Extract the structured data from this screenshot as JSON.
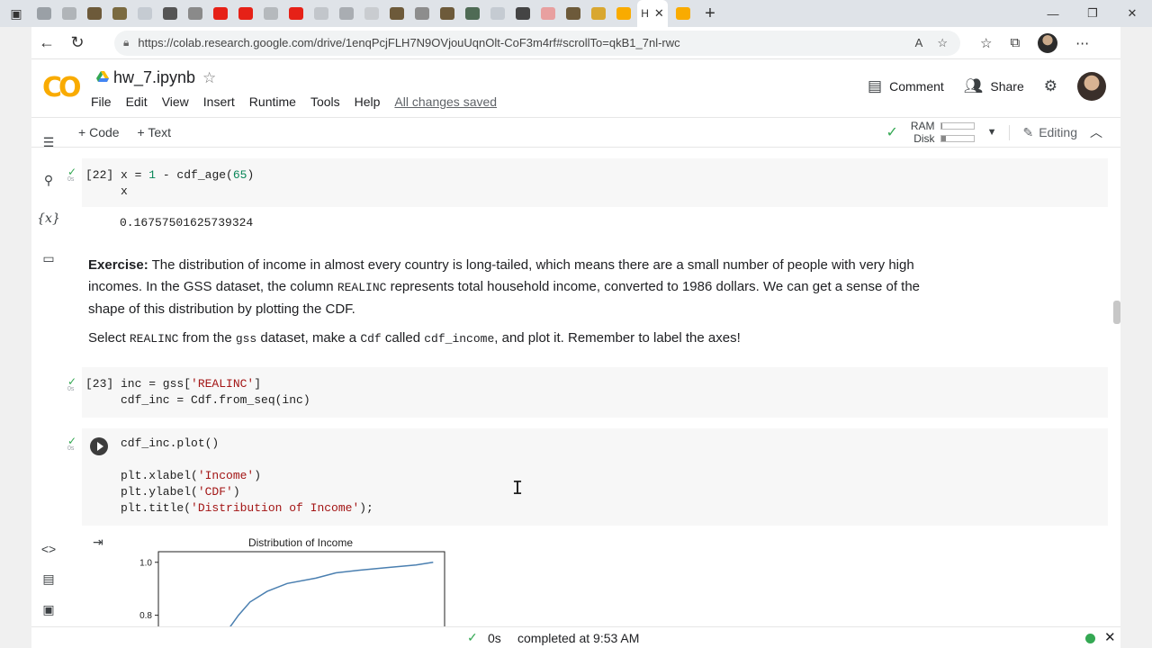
{
  "browser": {
    "active_tab_label": "H",
    "url": "https://colab.research.google.com/drive/1enqPcjFLH7N9OVjouUqnOlt-CoF3m4rf#scrollTo=qkB1_7nl-rwc"
  },
  "header": {
    "logo_text": "CO",
    "notebook_title": "hw_7.ipynb",
    "menu": [
      "File",
      "Edit",
      "View",
      "Insert",
      "Runtime",
      "Tools",
      "Help"
    ],
    "save_status": "All changes saved",
    "comment_label": "Comment",
    "share_label": "Share"
  },
  "toolbar": {
    "add_code": "Code",
    "add_text": "Text",
    "ram_label": "RAM",
    "disk_label": "Disk",
    "ram_level": 0.05,
    "disk_level": 0.15,
    "editing_label": "Editing"
  },
  "cells": {
    "c22": {
      "exec": "[22]",
      "line1_a": "x = ",
      "line1_num": "1",
      "line1_b": " - cdf_age(",
      "line1_arg": "65",
      "line1_c": ")",
      "line2": "x",
      "time": "0s",
      "output": "0.16757501625739324"
    },
    "text1": {
      "bold": "Exercise:",
      "p1_a": " The distribution of income in almost every country is long-tailed, which means there are a small number of people with very high incomes. In the GSS dataset, the column ",
      "p1_code": "REALINC",
      "p1_b": " represents total household income, converted to 1986 dollars. We can get a sense of the shape of this distribution by plotting the CDF.",
      "p2_a": "Select ",
      "p2_code1": "REALINC",
      "p2_b": " from the ",
      "p2_code2": "gss",
      "p2_c": " dataset, make a ",
      "p2_code3": "Cdf",
      "p2_d": " called ",
      "p2_code4": "cdf_income",
      "p2_e": ", and plot it. Remember to label the axes!"
    },
    "c23": {
      "exec": "[23]",
      "line1_a": "inc = gss[",
      "line1_str": "'REALINC'",
      "line1_b": "]",
      "line2": "cdf_inc = Cdf.from_seq(inc)",
      "time": "0s"
    },
    "c24": {
      "line1": "cdf_inc.plot()",
      "l2_a": "plt.xlabel(",
      "l2_str": "'Income'",
      "l2_b": ")",
      "l3_a": "plt.ylabel(",
      "l3_str": "'CDF'",
      "l3_b": ")",
      "l4_a": "plt.title(",
      "l4_str": "'Distribution of Income'",
      "l4_b": ");",
      "time": "0s"
    }
  },
  "chart_data": {
    "type": "line",
    "title": "Distribution of Income",
    "xlabel": "",
    "ylabel": "",
    "y_ticks": [
      "1.0",
      "0.8"
    ],
    "ylim": [
      0.7,
      1.04
    ],
    "xlim": [
      0,
      1
    ],
    "x": [
      0.21,
      0.24,
      0.28,
      0.32,
      0.38,
      0.45,
      0.55,
      0.62,
      0.7,
      0.8,
      0.9,
      0.96
    ],
    "y": [
      0.68,
      0.74,
      0.8,
      0.85,
      0.89,
      0.92,
      0.94,
      0.96,
      0.97,
      0.98,
      0.99,
      1.0
    ],
    "grid": false,
    "line_color": "#4a7fb0"
  },
  "status": {
    "duration": "0s",
    "message": "completed at 9:53 AM"
  }
}
